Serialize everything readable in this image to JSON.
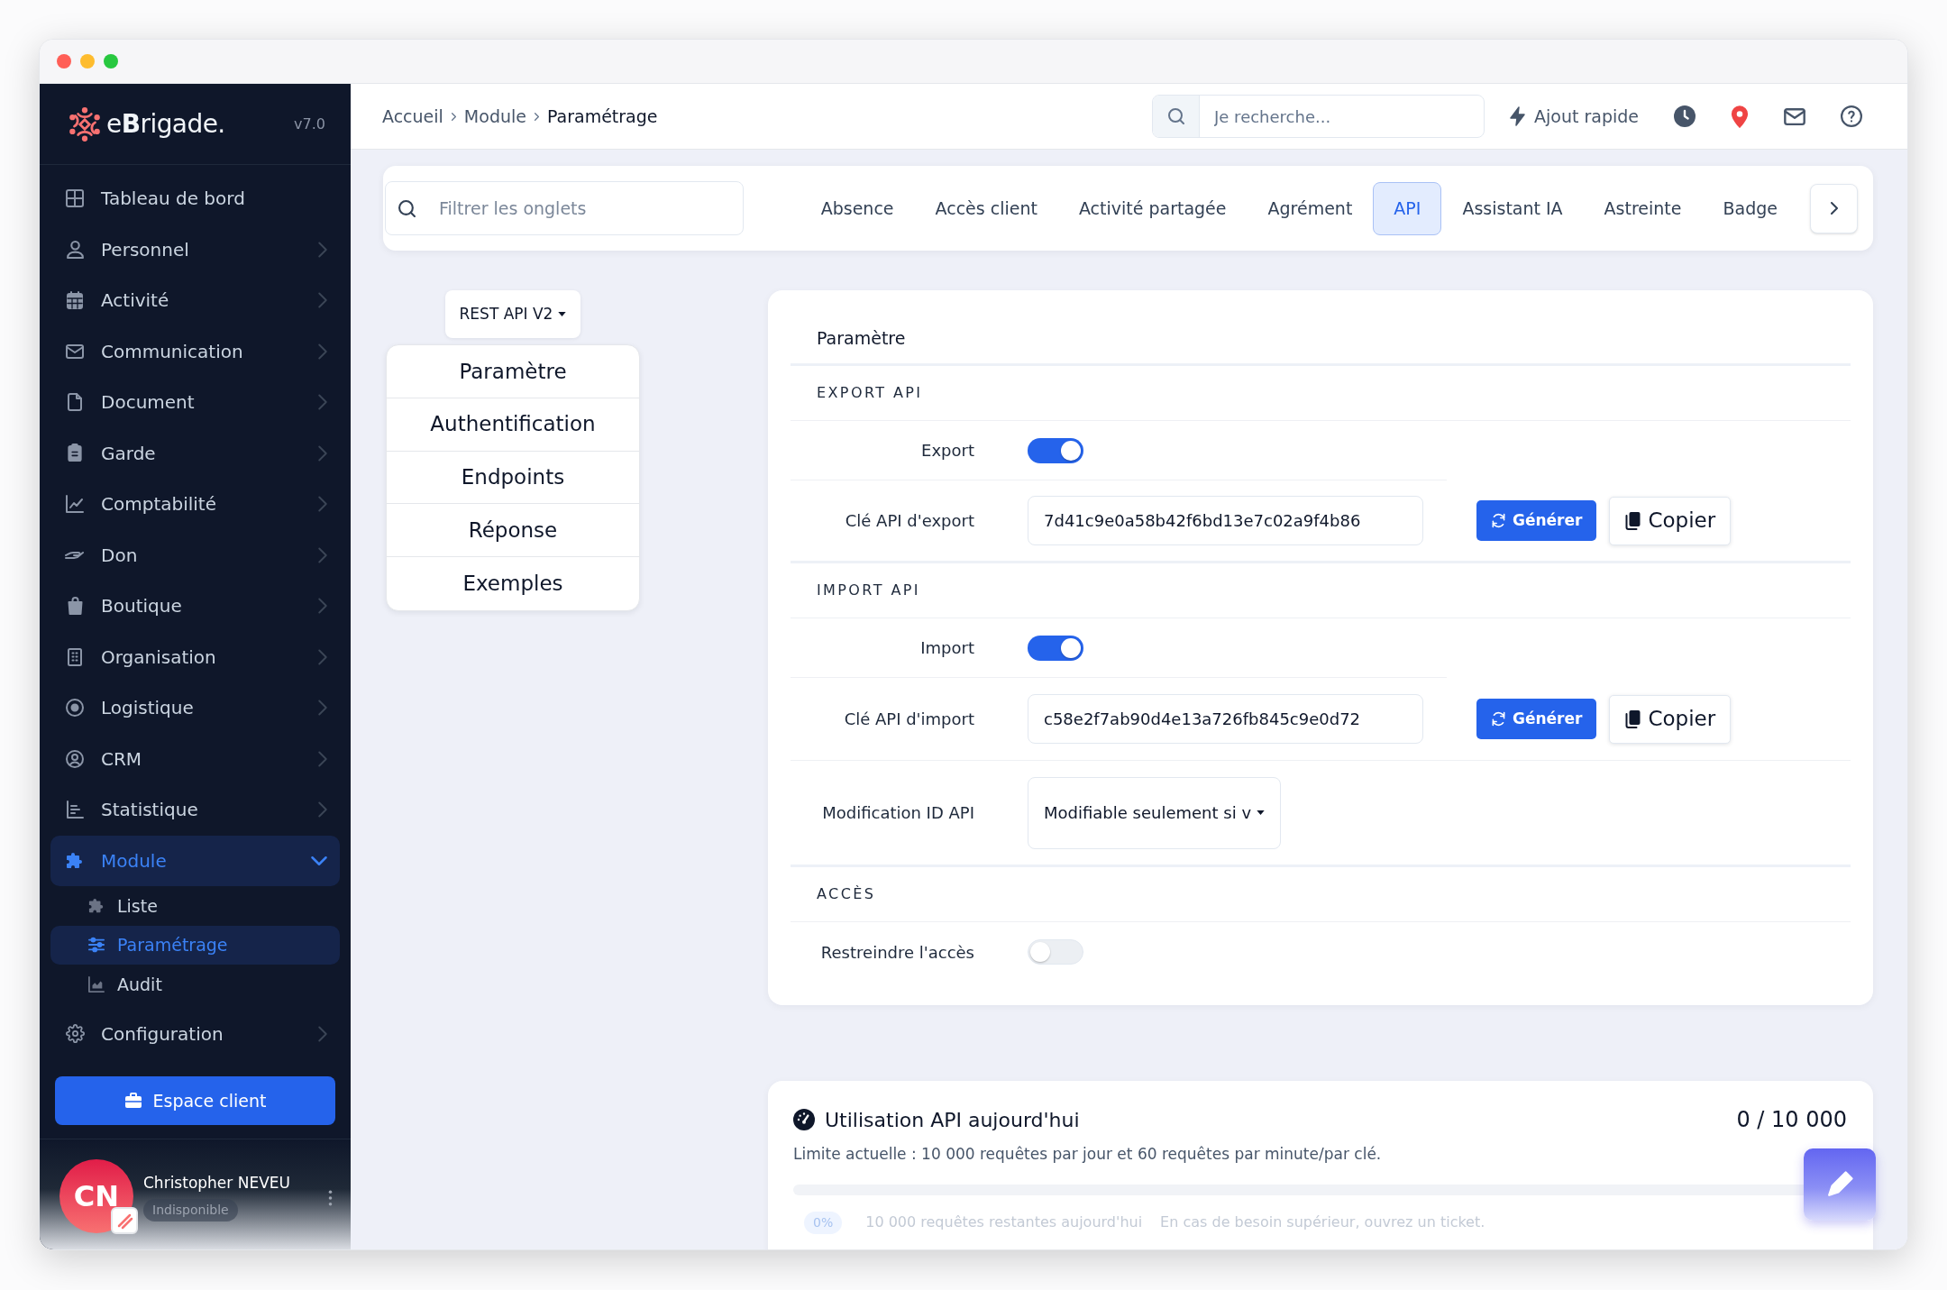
{
  "sidebar": {
    "logo": "e**B**rigade.",
    "version": "v7.0",
    "items": [
      {
        "kind": "link",
        "label": "Tableau de bord",
        "selected": false
      },
      {
        "kind": "group",
        "label": "Personnel",
        "selected": false,
        "expanded": false
      },
      {
        "kind": "group",
        "label": "Activité",
        "selected": false,
        "expanded": false
      },
      {
        "kind": "group",
        "label": "Communication",
        "selected": false,
        "expanded": false
      },
      {
        "kind": "group",
        "label": "Document",
        "selected": false,
        "expanded": false
      },
      {
        "kind": "group",
        "label": "Garde",
        "selected": false,
        "expanded": false
      },
      {
        "kind": "group",
        "label": "Comptabilité",
        "selected": false,
        "expanded": false
      },
      {
        "kind": "group",
        "label": "Don",
        "selected": false,
        "expanded": false
      },
      {
        "kind": "group",
        "label": "Boutique",
        "selected": false,
        "expanded": false
      },
      {
        "kind": "group",
        "label": "Organisation",
        "selected": false,
        "expanded": false
      },
      {
        "kind": "group",
        "label": "Logistique",
        "selected": false,
        "expanded": false
      },
      {
        "kind": "group",
        "label": "CRM",
        "selected": false,
        "expanded": false
      },
      {
        "kind": "group",
        "label": "Statistique",
        "selected": false,
        "expanded": false
      },
      {
        "kind": "group",
        "label": "Module",
        "selected": true,
        "expanded": true,
        "children": [
          {
            "label": "Liste",
            "selected": false
          },
          {
            "label": "Paramétrage",
            "selected": true
          },
          {
            "label": "Audit",
            "selected": false
          }
        ]
      },
      {
        "kind": "group",
        "label": "Configuration",
        "selected": false,
        "expanded": false
      }
    ],
    "client_button": "Espace client",
    "user": {
      "initials": "CN",
      "name": "Christopher NEVEU",
      "status": "Indisponible"
    }
  },
  "topbar": {
    "breadcrumb": [
      "Accueil",
      "Module",
      "Paramétrage"
    ],
    "search": {
      "placeholder": "Je recherche..."
    },
    "quick_add": "Ajout rapide"
  },
  "tab_bar": {
    "filter": {
      "placeholder": "Filtrer les onglets"
    },
    "tabs": [
      {
        "label": "Absence",
        "selected": false
      },
      {
        "label": "Accès client",
        "selected": false
      },
      {
        "label": "Activité partagée",
        "selected": false
      },
      {
        "label": "Agrément",
        "selected": false
      },
      {
        "label": "API",
        "selected": true
      },
      {
        "label": "Assistant IA",
        "selected": false
      },
      {
        "label": "Astreinte",
        "selected": false
      },
      {
        "label": "Badge",
        "selected": false
      }
    ]
  },
  "api_version": "REST API V2",
  "section_nav": [
    {
      "label": "Paramètre",
      "selected": false
    },
    {
      "label": "Authentification",
      "selected": false
    },
    {
      "label": "Endpoints",
      "selected": false
    },
    {
      "label": "Réponse",
      "selected": false
    },
    {
      "label": "Exemples",
      "selected": false
    }
  ],
  "settings": {
    "title": "Paramètre",
    "sections": [
      {
        "title": "EXPORT API",
        "rows": [
          {
            "kind": "toggle",
            "label": "Export",
            "on": true
          },
          {
            "kind": "key",
            "label": "Clé API d'export",
            "value": "7d41c9e0a58b42f6bd13e7c02a9f4b86",
            "buttons": [
              {
                "kind": "generate",
                "label": "Générer"
              },
              {
                "kind": "copy",
                "label": "Copier"
              }
            ]
          }
        ]
      },
      {
        "title": "IMPORT API",
        "rows": [
          {
            "kind": "toggle",
            "label": "Import",
            "on": true
          },
          {
            "kind": "key",
            "label": "Clé API d'import",
            "value": "c58e2f7ab90d4e13a726fb845c9e0d72",
            "buttons": [
              {
                "kind": "generate",
                "label": "Générer"
              },
              {
                "kind": "copy",
                "label": "Copier"
              }
            ]
          },
          {
            "kind": "select",
            "label": "Modification ID API",
            "value": "Modifiable seulement si v"
          }
        ]
      },
      {
        "title": "ACCÈS",
        "rows": [
          {
            "kind": "toggle",
            "label": "Restreindre l'accès",
            "on": false
          }
        ]
      }
    ]
  },
  "usage": {
    "title": "Utilisation API aujourd'hui",
    "count": "0 / 10 000",
    "limit": "Limite actuelle : 10 000 requêtes par jour et 60 requêtes par minute/par clé.",
    "percent": "0%",
    "remaining": "10 000 requêtes restantes aujourd'hui",
    "note": "En cas de besoin supérieur, ouvrez un ticket."
  }
}
